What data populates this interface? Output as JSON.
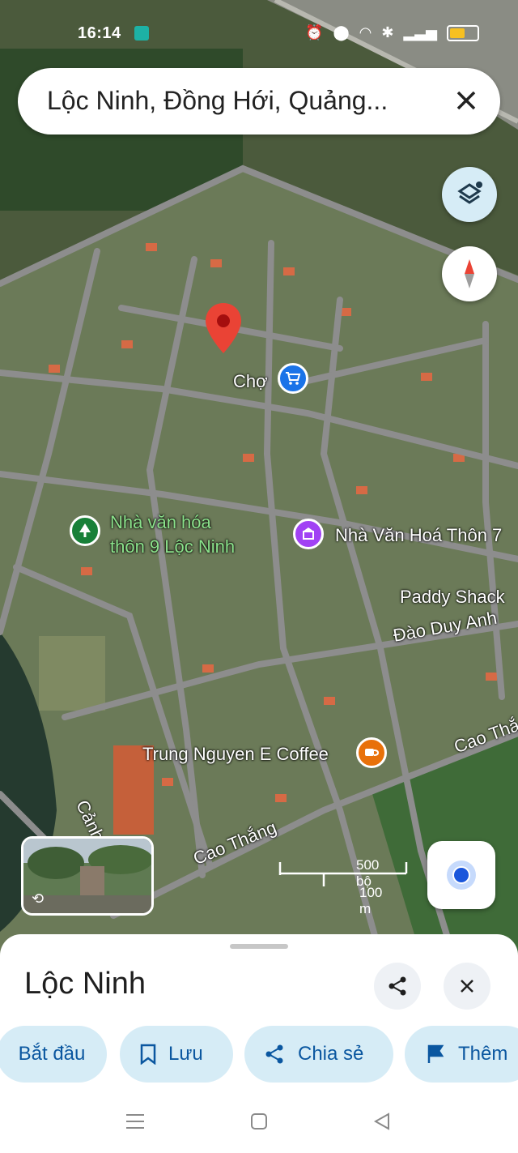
{
  "status_bar": {
    "time": "16:14"
  },
  "search": {
    "query": "Lộc Ninh, Đồng Hới, Quảng..."
  },
  "map": {
    "places": [
      {
        "name": "Chợ",
        "category": "market"
      },
      {
        "name": "Nhà văn hóa thôn 9 Lộc Ninh",
        "category": "park"
      },
      {
        "name": "Nhà Văn Hoá Thôn 7",
        "category": "community"
      },
      {
        "name": "Paddy Shack",
        "category": "place"
      },
      {
        "name": "Trung Nguyen E Coffee",
        "category": "cafe"
      }
    ],
    "place_label_lines": {
      "culture_house_9_line1": "Nhà văn hóa",
      "culture_house_9_line2": "thôn 9 Lộc Ninh"
    },
    "streets": [
      "Đào Duy Anh",
      "Cao Thắng",
      "Cao Thắ",
      "Cảnh D"
    ],
    "scale": {
      "imperial": "500 bộ",
      "metric": "100 m"
    }
  },
  "sheet": {
    "title": "Lộc Ninh",
    "actions": [
      {
        "label": "Bắt đầu",
        "icon": "navigation-start-icon"
      },
      {
        "label": "Lưu",
        "icon": "bookmark-icon"
      },
      {
        "label": "Chia sẻ",
        "icon": "share-icon"
      },
      {
        "label": "Thêm",
        "icon": "flag-icon"
      }
    ]
  },
  "colors": {
    "accent": "#0b57a0",
    "chip_bg": "#d6ecf6",
    "pin": "#ea4335",
    "market": "#1a73e8",
    "park": "#188038",
    "community": "#a142f4",
    "cafe": "#e8710a"
  }
}
